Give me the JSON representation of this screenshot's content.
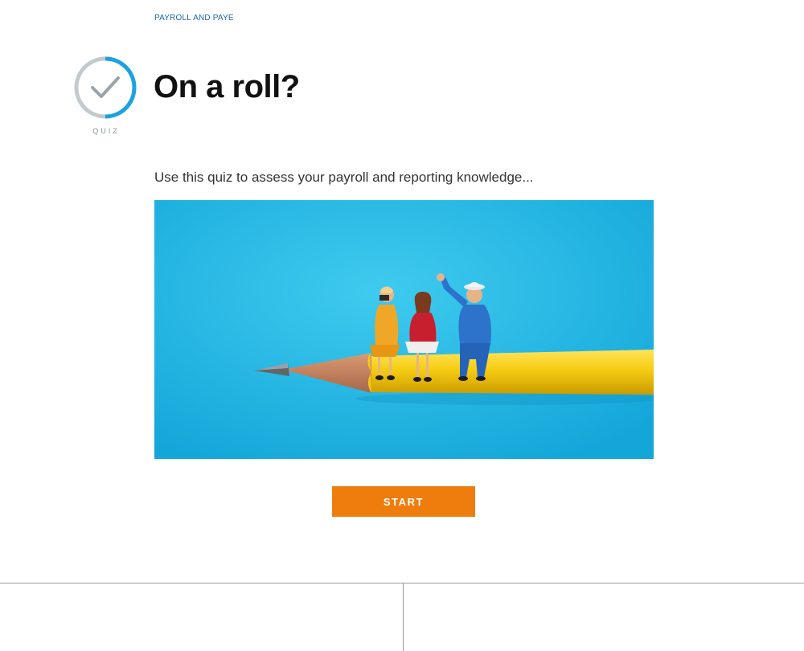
{
  "breadcrumb": {
    "label": "PAYROLL AND PAYE"
  },
  "badge": {
    "icon": "check-circle-icon",
    "label": "QUIZ",
    "progress_fraction": 0.5,
    "progress_color": "#1aa3de",
    "track_color": "#c3cacd"
  },
  "header": {
    "title": "On a roll?"
  },
  "main": {
    "intro": "Use this quiz to assess your payroll and reporting knowledge...",
    "hero_image": "miniature-figures-on-pencil-image",
    "start_label": "START"
  },
  "colors": {
    "accent": "#ee7d0d",
    "link": "#1b66a8",
    "hero_background": "#2cb8e6"
  }
}
